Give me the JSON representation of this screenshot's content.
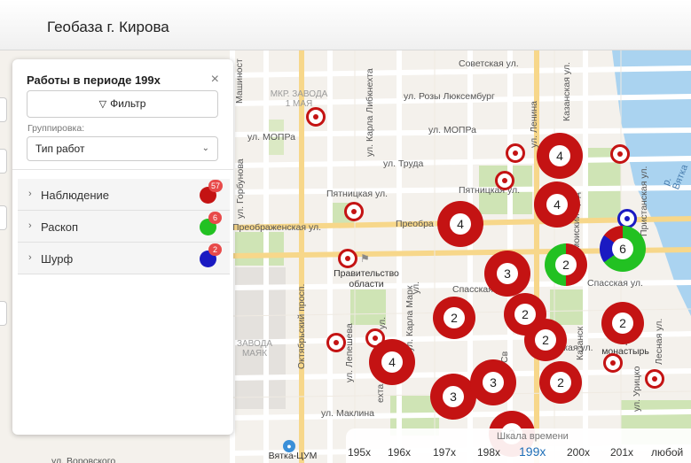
{
  "header": {
    "title": "Геобаза г. Кирова"
  },
  "panel": {
    "title": "Работы в периоде 199x",
    "close_icon": "close-icon",
    "filter_label": "Фильтр",
    "filter_icon": "filter-icon",
    "grouping_label": "Группировка:",
    "grouping_value": "Тип работ",
    "types": [
      {
        "label": "Наблюдение",
        "count": "57",
        "color": "#c41313"
      },
      {
        "label": "Раскоп",
        "count": "6",
        "color": "#22c122"
      },
      {
        "label": "Шурф",
        "count": "2",
        "color": "#1a1ac2"
      }
    ]
  },
  "map": {
    "streets": {
      "sovetskaya": "Советская ул.",
      "rozy": "ул. Розы Люксембург",
      "mopra1": "ул. МОПРа",
      "mopra2": "ул. МОПРа",
      "truda": "ул. Труда",
      "pyatnitskaya1": "Пятницкая ул.",
      "pyatnitskaya2": "Пятницкая ул.",
      "preobr1": "Преображенская ул.",
      "preobr2": "Преобра",
      "spasskaya1": "Спасская ул.",
      "spasskaya2": "Спасская ул.",
      "maklina": "ул. Маклина",
      "vorovskogo": "ул. Воровского",
      "oktyabrsky": "Октябрьский просп.",
      "karla_libk": "ул. Карла Либкнехта",
      "karla_marksa": "ул. Карла Марк",
      "lenina": "ул. Ленина",
      "kazanskaya": "Казанская ул.",
      "gorbunova": "ул. Горбунова",
      "mashinostr": "Машиност",
      "lepeshevo": "ул. Лепешева",
      "pristanskaya": "Пристанская ул.",
      "lesnaya": "Лесная ул.",
      "urickogo": "ул. Урицко",
      "ekhta": "ехта",
      "moisky": "моиский пр-д",
      "sv": "ул. Св",
      "kazansk2": "Казанск",
      "rnovskaya": "рновская ул.",
      "ul_short": "ул.",
      "ul_short2": "ул."
    },
    "districts": {
      "zavod1": "МКР. ЗАВОДА\n1 МАЯ",
      "zavod2": "ЗАВОДА\nМАЯК"
    },
    "poi": {
      "pravitelstvo": "Правительство\nобласти",
      "monastyr": "Тр\nмонастырь",
      "vyatka_cum": "Вятка-ЦУМ"
    },
    "river": "р. Вятка",
    "clusters": [
      "4",
      "4",
      "4",
      "2",
      "6",
      "3",
      "2",
      "2",
      "2",
      "2",
      "4",
      "3",
      "2",
      "3",
      "2"
    ]
  },
  "timeline": {
    "title": "Шкала времени",
    "items": [
      "195x",
      "196x",
      "197x",
      "198x",
      "199x",
      "200x",
      "201x",
      "любой"
    ],
    "active": "199x"
  },
  "colors": {
    "red": "#c41313",
    "green": "#22c122",
    "blue": "#1a1ac2",
    "accent": "#1f6fb8"
  }
}
